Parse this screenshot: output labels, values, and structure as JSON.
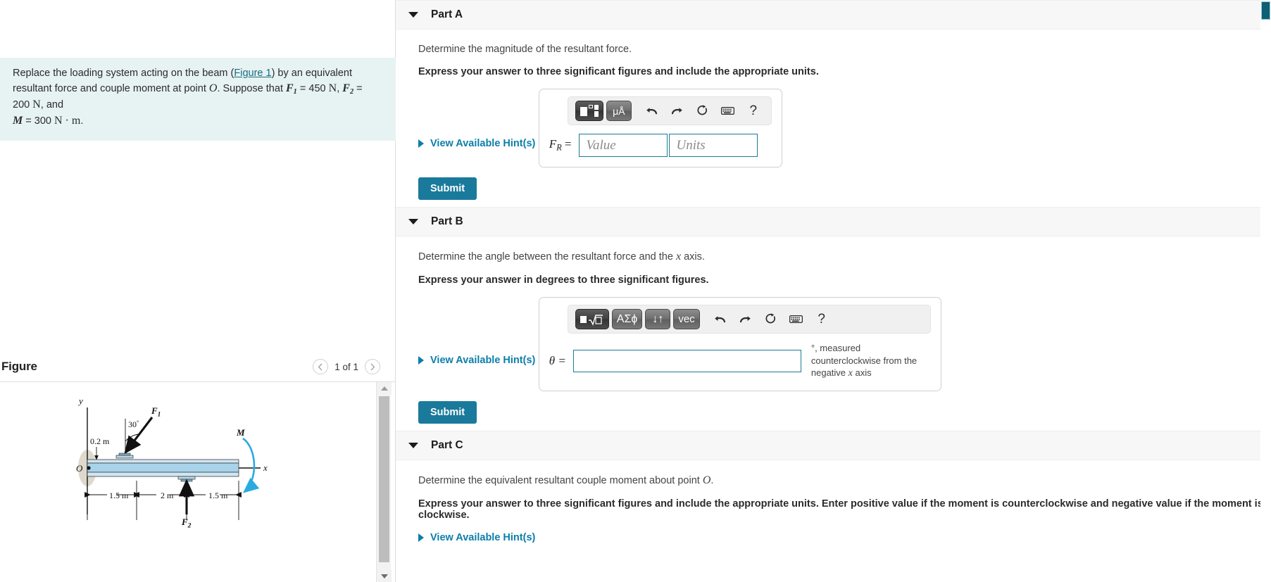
{
  "left": {
    "problem": {
      "line1_a": "Replace the loading system acting on the beam (",
      "figure_link": "Figure 1",
      "line1_b": ") by an equivalent resultant force and couple moment at point ",
      "point": "O",
      "line1_c": ". Suppose that ",
      "f1_label": "F",
      "f1_sub": "1",
      "f1_value": " = 450 ",
      "f1_unit": "N",
      "comma1": ", ",
      "f2_label": "F",
      "f2_sub": "2",
      "f2_value": " = 200 ",
      "f2_unit": "N",
      "comma2": ", and ",
      "m_label": "M",
      "m_value": " = 300 ",
      "m_unit": "N · m",
      "period": "."
    },
    "figure": {
      "title": "Figure",
      "pager_label": "1 of 1",
      "prev_icon": "chevron-left-icon",
      "next_icon": "chevron-right-icon",
      "labels": {
        "y_axis": "y",
        "x_axis": "x",
        "origin": "O",
        "force1": "F",
        "force1_sub": "1",
        "force2": "F",
        "force2_sub": "2",
        "moment": "M",
        "angle": "30°",
        "offset": "0.2 m",
        "dim1": "1.5 m",
        "dim2": "2 m",
        "dim3": "1.5 m"
      }
    }
  },
  "parts": [
    {
      "id": "part-a",
      "title": "Part A",
      "prompt": "Determine the magnitude of the resultant force.",
      "instruction": "Express your answer to three significant figures and include the appropriate units.",
      "hints_label": "View Available Hint(s)",
      "toolbar": [
        {
          "name": "template-button",
          "label": "",
          "kind": "template",
          "dark": true
        },
        {
          "name": "units-button",
          "label": "μÅ",
          "kind": "text",
          "dark": false
        },
        {
          "name": "undo-icon",
          "label": "↶",
          "kind": "icon"
        },
        {
          "name": "redo-icon",
          "label": "↷",
          "kind": "icon"
        },
        {
          "name": "reset-icon",
          "label": "↻",
          "kind": "icon"
        },
        {
          "name": "keyboard-icon",
          "label": "⌨",
          "kind": "icon"
        },
        {
          "name": "help-icon",
          "label": "?",
          "kind": "icon"
        }
      ],
      "answer_label": "F",
      "answer_label_sub": "R",
      "answer_label_eq": " =",
      "value_placeholder": "Value",
      "units_placeholder": "Units",
      "value_current": "",
      "units_current": "",
      "submit_label": "Submit"
    },
    {
      "id": "part-b",
      "title": "Part B",
      "prompt_a": "Determine the angle between the resultant force and the ",
      "prompt_var": "x",
      "prompt_b": " axis.",
      "instruction": "Express your answer in degrees to three significant figures.",
      "hints_label": "View Available Hint(s)",
      "toolbar": [
        {
          "name": "sqrt-button",
          "label": "",
          "kind": "sqrt",
          "dark": true
        },
        {
          "name": "greek-button",
          "label": "ΑΣϕ",
          "kind": "text",
          "dark": false
        },
        {
          "name": "arrows-button",
          "label": "↓↑",
          "kind": "text",
          "dark": false
        },
        {
          "name": "vec-button",
          "label": "vec",
          "kind": "text",
          "dark": false
        },
        {
          "name": "undo-icon",
          "label": "↶",
          "kind": "icon"
        },
        {
          "name": "redo-icon",
          "label": "↷",
          "kind": "icon"
        },
        {
          "name": "reset-icon",
          "label": "↻",
          "kind": "icon"
        },
        {
          "name": "keyboard-icon",
          "label": "⌨",
          "kind": "icon"
        },
        {
          "name": "help-icon",
          "label": "?",
          "kind": "icon"
        }
      ],
      "answer_label": "θ =",
      "theta_current": "",
      "unit_note_a": "°, measured counterclockwise from the negative ",
      "unit_note_var": "x",
      "unit_note_b": " axis",
      "submit_label": "Submit"
    },
    {
      "id": "part-c",
      "title": "Part C",
      "prompt_a": "Determine the equivalent resultant couple moment about point ",
      "prompt_var": "O",
      "prompt_b": ".",
      "instruction": "Express your answer to three significant figures and include the appropriate units. Enter positive value if the moment is counterclockwise and negative value if the moment is clockwise.",
      "hints_label": "View Available Hint(s)"
    }
  ],
  "colors": {
    "accent": "#1a7a9b",
    "link": "#0c7eaa",
    "problem_bg": "#e6f3f2",
    "part_header_bg": "#f7f7f7",
    "input_border": "#1b7b95",
    "beam_fill": "#a8d3ea",
    "moment_arrow": "#29abe2"
  }
}
